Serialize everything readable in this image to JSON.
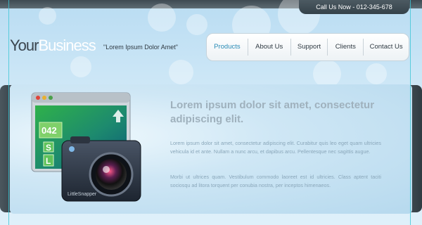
{
  "header": {
    "call_text": "Call Us Now - 012-345-678",
    "logo_dark": "Your",
    "logo_light": "Business",
    "tagline": "\"Lorem Ipsum Dolor Amet\""
  },
  "nav": {
    "items": [
      {
        "label": "Products",
        "active": true
      },
      {
        "label": "About Us",
        "active": false
      },
      {
        "label": "Support",
        "active": false
      },
      {
        "label": "Clients",
        "active": false
      },
      {
        "label": "Contact Us",
        "active": false
      }
    ]
  },
  "banner": {
    "headline": "Lorem ipsum dolor sit amet, consectetur adipiscing elit.",
    "paragraph1": "Lorem ipsum dolor sit amet, consectetur adipiscing elit. Curabitur quis leo eget quam ultricies vehicula id et ante. Nullam a nunc arcu, et dapibus arcu. Pellentesque nec sagittis augue.",
    "paragraph2": "Morbi ut ultrices quam. Vestibulum commodo laoreet est id ultricies. Class aptent taciti sociosqu ad litora torquent per conubia nostra, per inceptos himenaeos.",
    "illustration": {
      "window_number": "042",
      "window_letter_s": "S",
      "window_letter_l": "L",
      "camera_label": "LittleSnapper"
    }
  },
  "colors": {
    "accent": "#2a8cb6",
    "dark_bar": "#3e4a52",
    "headline": "#9fb1bd",
    "body_text": "#8aa7ba"
  },
  "icons": [
    "browser-window-icon",
    "camera-icon"
  ]
}
